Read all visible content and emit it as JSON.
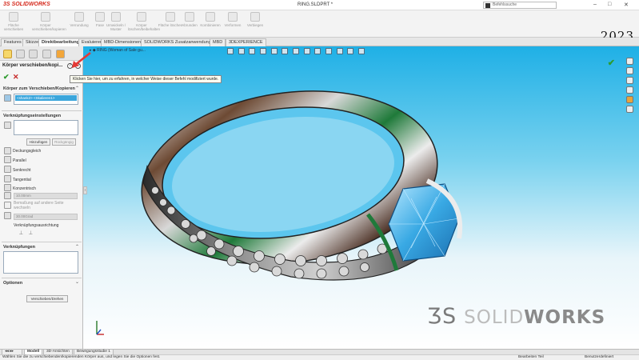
{
  "app": {
    "brand": "SOLIDWORKS",
    "document_title": "RING.SLDPRT *",
    "search_placeholder": "Befehlssuche",
    "year_badge": "2023"
  },
  "ribbon": {
    "buttons": [
      {
        "label": "Fläche verschieben",
        "icon": "move-face-icon"
      },
      {
        "label": "Körper verschieben/kopieren",
        "icon": "move-copy-body-icon"
      },
      {
        "label": "Verrundung",
        "icon": "fillet-icon"
      },
      {
        "label": "Fase",
        "icon": "chamfer-icon"
      },
      {
        "label": "Umwickeln / Muster",
        "icon": "wrap-icon"
      },
      {
        "label": "Körper löschen/beibehalten",
        "icon": "delete-body-icon"
      },
      {
        "label": "Fläche löschen",
        "icon": "delete-face-icon"
      },
      {
        "label": "Abrunden",
        "icon": "round-icon"
      },
      {
        "label": "Kombinieren",
        "icon": "combine-icon"
      },
      {
        "label": "Verformen",
        "icon": "deform-icon"
      },
      {
        "label": "Verbiegen",
        "icon": "flex-icon"
      }
    ]
  },
  "tabs": [
    "Features",
    "Skizze",
    "Direktbearbeitung",
    "Evaluieren",
    "MBD-Dimensionen",
    "SOLIDWORKS Zusatzanwendungen",
    "MBD",
    "3DEXPERIENCE"
  ],
  "active_tab": "Direktbearbeitung",
  "property_manager": {
    "title": "Körper verschieben/kopi...",
    "tooltip": "Klicken Sie hier, um zu erfahren, in welcher Weise dieser Befehl modifiziert wurde.",
    "bodies_section": "Körper zum Verschieben/Kopieren",
    "selected_body": "<shank2> <Skalieren1>",
    "mates_settings": "Verknüpfungseinstellungen",
    "add_button": "Hinzufügen",
    "undo_button": "Rückgängig",
    "mate_types": [
      "Deckungsgleich",
      "Parallel",
      "Senkrecht",
      "Tangential",
      "Konzentrisch"
    ],
    "distance_value": "10.00mm",
    "flip_dimension": "Bemaßung auf andere Seite wechseln",
    "angle_value": "30.00Grad",
    "alignment_label": "Verknüpfungsausrichtung",
    "mates_section": "Verknüpfungen",
    "options_section": "Optionen",
    "move_rotate_button": "Verschieben/Drehen"
  },
  "viewport": {
    "tree_label": "RING (Woman of Sale gu...",
    "watermark_prefix": "SOLID",
    "watermark_suffix": "WORKS"
  },
  "bottom_tabs": [
    "Modell",
    "3D-Ansichten",
    "Bewegungsstudie 1"
  ],
  "active_bottom_tab": "Modell",
  "status": {
    "message": "Wählen Sie die zu verschiebenden/kopierenden Körper aus, und legen Sie die Optionen fest.",
    "mode": "Bearbeiten Teil",
    "units": "Benutzerdefiniert"
  },
  "colors": {
    "brand_red": "#d52b1e",
    "selection_blue": "#3ba6dc",
    "accept_green": "#2d9b2d",
    "annotation_red": "#e53935"
  }
}
